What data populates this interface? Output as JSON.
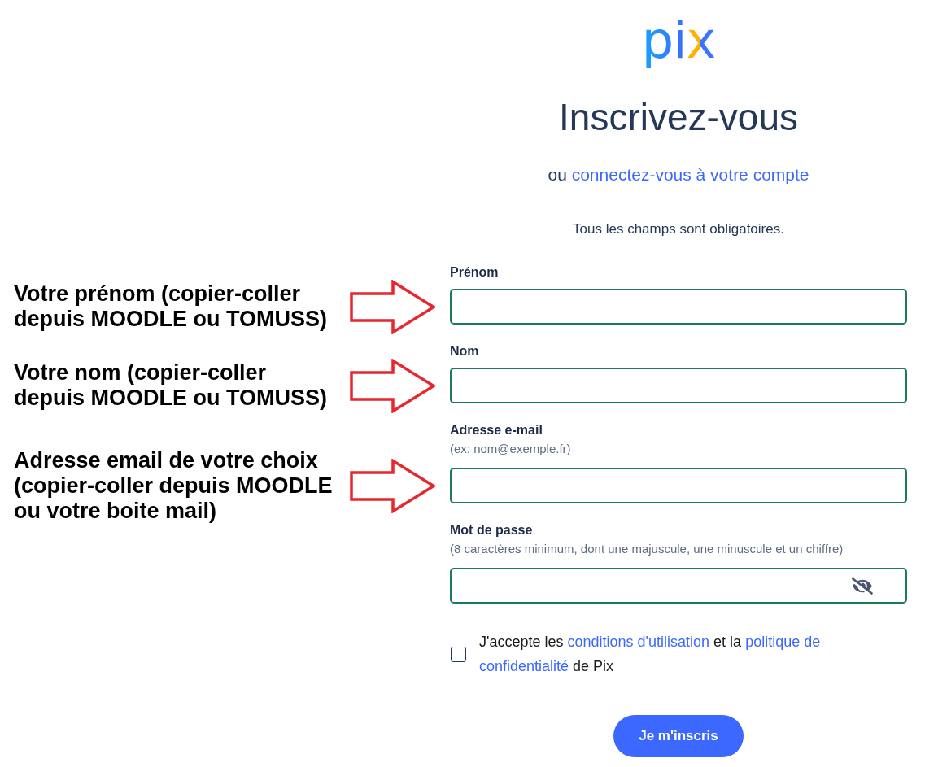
{
  "header": {
    "logo": "pix",
    "title": "Inscrivez-vous",
    "prompt": {
      "text": "ou",
      "link": "connectez-vous à votre compte"
    },
    "note": "Tous les champs sont obligatoires."
  },
  "fields": [
    {
      "kind": "text",
      "label": "Prénom",
      "annotation": "Votre prénom (copier-coller depuis MOODLE ou TOMUSS)"
    },
    {
      "kind": "text",
      "label": "Nom",
      "annotation": "Votre nom (copier-coller depuis MOODLE ou TOMUSS)"
    },
    {
      "kind": "email",
      "label": "Adresse e-mail",
      "hint": "(ex: nom@exemple.fr)",
      "annotation": "Adresse email de votre choix (copier-coller depuis MOODLE ou votre boite mail)"
    },
    {
      "kind": "password",
      "label": "Mot de passe",
      "hint": "(8 caractères minimum, dont une majuscule, une minuscule et un chiffre)"
    }
  ],
  "terms": {
    "checked": false,
    "parts": [
      {
        "kind": "text",
        "text": "J'accepte les"
      },
      {
        "kind": "link",
        "text": "conditions d'utilisation"
      },
      {
        "kind": "text",
        "text": "et la"
      },
      {
        "kind": "link",
        "text": "politique de"
      },
      {
        "kind": "link",
        "text": "confidentialité"
      },
      {
        "kind": "text",
        "text": "de Pix"
      }
    ]
  },
  "submit": "Je m'inscris"
}
